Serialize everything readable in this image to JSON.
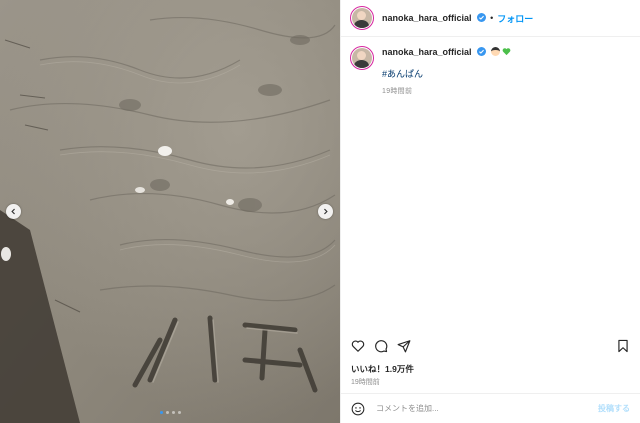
{
  "post": {
    "username": "nanoka_hara_official",
    "verified": true,
    "separator": "•",
    "follow_label": "フォロー"
  },
  "caption": {
    "username": "nanoka_hara_official",
    "emoji": [
      "person-face-emoji",
      "green-heart-emoji"
    ],
    "hashtag": "#あんぱん",
    "time_ago": "19時間前"
  },
  "media": {
    "photo_subject": "sand-beach-photo",
    "carousel_count": 4,
    "carousel_active_index": 0,
    "prev_icon": "chevron-left-icon",
    "next_icon": "chevron-right-icon"
  },
  "actions": {
    "icons": [
      "heart-icon",
      "comment-icon",
      "share-icon",
      "bookmark-icon"
    ]
  },
  "likes_text": "いいね！1.9万件",
  "post_time": "19時間前",
  "comment": {
    "emoji_icon": "smiley-icon",
    "placeholder": "コメントを追加...",
    "post_label": "投稿する"
  },
  "colors": {
    "accent": "#0095f6",
    "hashtag": "#00376b",
    "verified": "#3897f0",
    "muted": "#8e8e8e",
    "post_disabled": "#b2dffc"
  }
}
